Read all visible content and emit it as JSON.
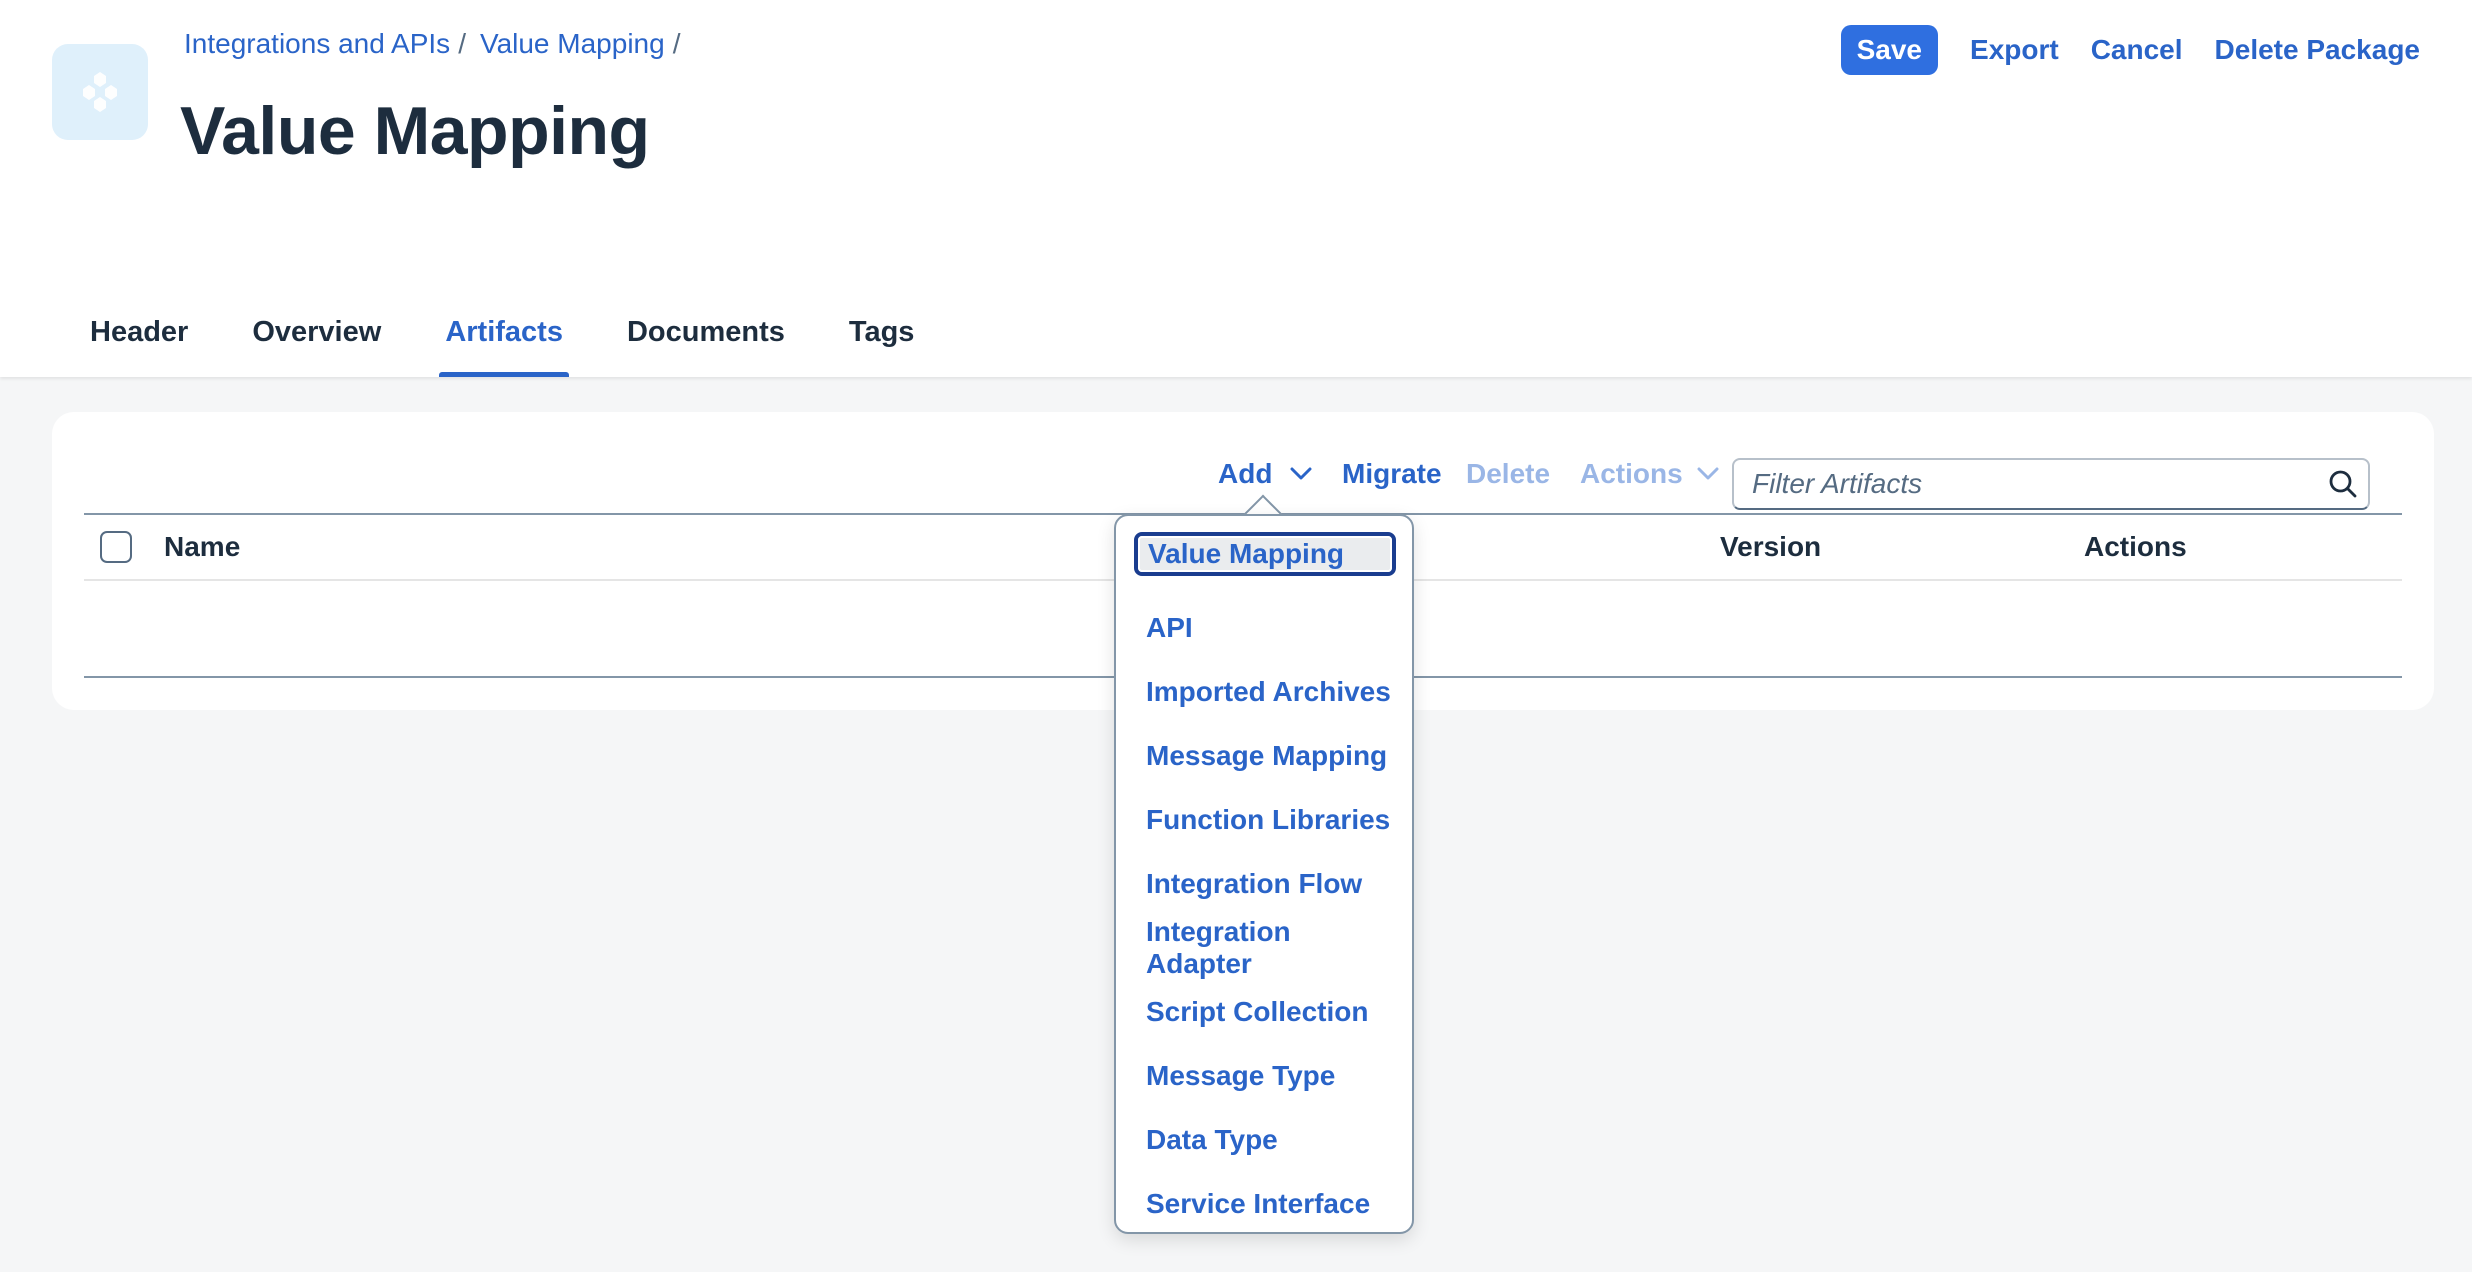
{
  "breadcrumb": [
    {
      "label": "Integrations and APIs",
      "sep": "/"
    },
    {
      "label": "Value Mapping",
      "sep": "/"
    }
  ],
  "page_title": "Value Mapping",
  "top_actions": {
    "save": "Save",
    "export": "Export",
    "cancel": "Cancel",
    "delete_package": "Delete Package"
  },
  "tabs": [
    {
      "label": "Header",
      "active": false
    },
    {
      "label": "Overview",
      "active": false
    },
    {
      "label": "Artifacts",
      "active": true
    },
    {
      "label": "Documents",
      "active": false
    },
    {
      "label": "Tags",
      "active": false
    }
  ],
  "toolbar": {
    "add": "Add",
    "migrate": "Migrate",
    "delete": "Delete",
    "actions": "Actions",
    "filter_placeholder": "Filter Artifacts"
  },
  "table": {
    "columns": [
      "Name",
      "Version",
      "Actions"
    ]
  },
  "add_menu": {
    "items": [
      "Value Mapping",
      "API",
      "Imported Archives",
      "Message Mapping",
      "Function Libraries",
      "Integration Flow",
      "Integration Adapter",
      "Script Collection",
      "Message Type",
      "Data Type",
      "Service Interface"
    ],
    "focused_index": 0
  },
  "colors": {
    "accent": "#2a64c8",
    "primary_button": "#2f6fe0",
    "disabled_text": "#9ab6e6",
    "title_text": "#1d2d3e",
    "background": "#f5f6f7"
  }
}
